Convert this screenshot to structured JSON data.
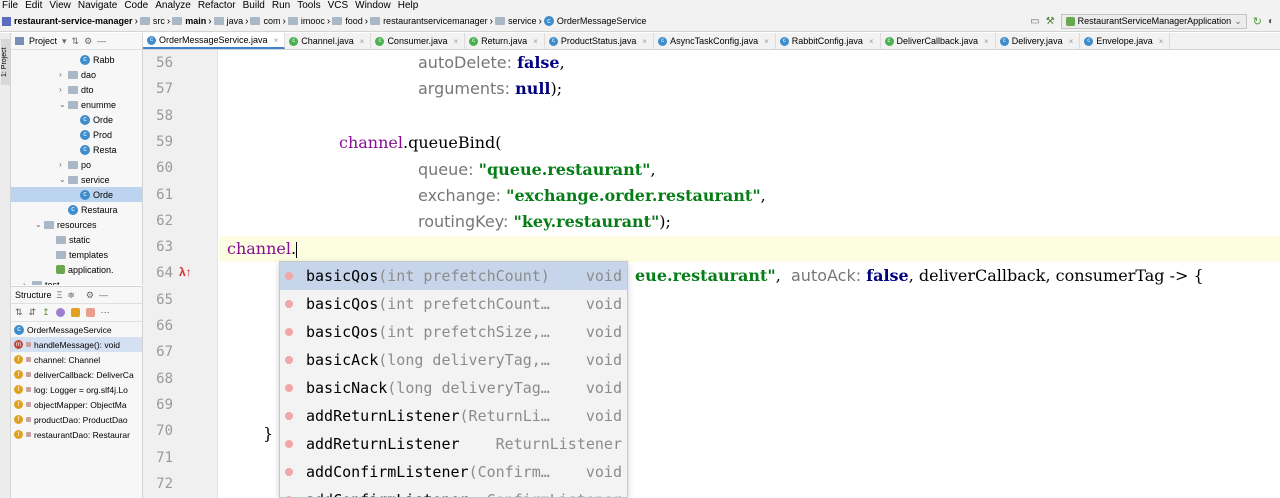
{
  "menu": [
    "File",
    "Edit",
    "View",
    "Navigate",
    "Code",
    "Analyze",
    "Refactor",
    "Build",
    "Run",
    "Tools",
    "VCS",
    "Window",
    "Help"
  ],
  "breadcrumb": [
    "restaurant-service-manager",
    "src",
    "main",
    "java",
    "com",
    "imooc",
    "food",
    "restaurantservicemanager",
    "service",
    "OrderMessageService"
  ],
  "run_config": "RestaurantServiceManagerApplication",
  "left_strip_label": "1: Project",
  "project_panel": {
    "title": "Project",
    "rows": [
      {
        "label": "Rabb",
        "indent": 5,
        "arrow": "",
        "icon": "class"
      },
      {
        "label": "dao",
        "indent": 4,
        "arrow": "›",
        "icon": "folder"
      },
      {
        "label": "dto",
        "indent": 4,
        "arrow": "›",
        "icon": "folder"
      },
      {
        "label": "enumme",
        "indent": 4,
        "arrow": "⌄",
        "icon": "folder"
      },
      {
        "label": "Orde",
        "indent": 5,
        "arrow": "",
        "icon": "class"
      },
      {
        "label": "Prod",
        "indent": 5,
        "arrow": "",
        "icon": "class"
      },
      {
        "label": "Resta",
        "indent": 5,
        "arrow": "",
        "icon": "class"
      },
      {
        "label": "po",
        "indent": 4,
        "arrow": "›",
        "icon": "folder"
      },
      {
        "label": "service",
        "indent": 4,
        "arrow": "⌄",
        "icon": "folder"
      },
      {
        "label": "Orde",
        "indent": 5,
        "arrow": "",
        "icon": "class",
        "selected": true
      },
      {
        "label": "Restaura",
        "indent": 4,
        "arrow": "",
        "icon": "class"
      },
      {
        "label": "resources",
        "indent": 2,
        "arrow": "⌄",
        "icon": "folder"
      },
      {
        "label": "static",
        "indent": 3,
        "arrow": "",
        "icon": "folder"
      },
      {
        "label": "templates",
        "indent": 3,
        "arrow": "",
        "icon": "folder"
      },
      {
        "label": "application.",
        "indent": 3,
        "arrow": "",
        "icon": "file"
      },
      {
        "label": "test",
        "indent": 1,
        "arrow": "›",
        "icon": "folder"
      }
    ]
  },
  "structure_panel": {
    "title": "Structure",
    "root": "OrderMessageService",
    "members": [
      {
        "badge": "m",
        "label": "handleMessage(): void",
        "selected": true
      },
      {
        "badge": "f",
        "label": "channel: Channel"
      },
      {
        "badge": "f",
        "label": "deliverCallback: DeliverCa"
      },
      {
        "badge": "f",
        "label": "log: Logger = org.slf4j.Lo"
      },
      {
        "badge": "f",
        "label": "objectMapper: ObjectMa"
      },
      {
        "badge": "f",
        "label": "productDao: ProductDao"
      },
      {
        "badge": "f",
        "label": "restaurantDao: Restaurar"
      }
    ]
  },
  "tabs": [
    {
      "label": "OrderMessageService.java",
      "active": true,
      "color": "#3d8ccb"
    },
    {
      "label": "Channel.java",
      "color": "#4caf50"
    },
    {
      "label": "Consumer.java",
      "color": "#4caf50"
    },
    {
      "label": "Return.java",
      "color": "#4caf50"
    },
    {
      "label": "ProductStatus.java",
      "color": "#3d8ccb"
    },
    {
      "label": "AsyncTaskConfig.java",
      "color": "#3d8ccb"
    },
    {
      "label": "RabbitConfig.java",
      "color": "#3d8ccb"
    },
    {
      "label": "DeliverCallback.java",
      "color": "#4caf50"
    },
    {
      "label": "Delivery.java",
      "color": "#3d8ccb"
    },
    {
      "label": "Envelope.java",
      "color": "#3d8ccb"
    }
  ],
  "editor": {
    "line_numbers": [
      "56",
      "57",
      "58",
      "59",
      "60",
      "61",
      "62",
      "63",
      "64",
      "65",
      "66",
      "67",
      "68",
      "69",
      "70",
      "71",
      "72"
    ],
    "l56_hint": "autoDelete:",
    "l56_val": "false",
    "l57_hint": "arguments:",
    "l57_val": "null",
    "l59_field": "channel",
    "l59_method": ".queueBind(",
    "l60_hint": "queue:",
    "l60_val": "\"queue.restaurant\"",
    "l61_hint": "exchange:",
    "l61_val": "\"exchange.order.restaurant\"",
    "l62_hint": "routingKey:",
    "l62_val": "\"key.restaurant\"",
    "l63_field": "channel",
    "l63_dot": ".",
    "l64_tail_str": "eue.restaurant\"",
    "l64_hint": "autoAck:",
    "l64_val": "false",
    "l64_rest": "deliverCallback, consumerTag -> {",
    "l70_brace": "}"
  },
  "completion": [
    {
      "name": "basicQos",
      "params": "(int prefetchCount)",
      "ret": "void",
      "selected": true
    },
    {
      "name": "basicQos",
      "params": "(int prefetchCount…",
      "ret": "void"
    },
    {
      "name": "basicQos",
      "params": "(int prefetchSize,…",
      "ret": "void"
    },
    {
      "name": "basicAck",
      "params": "(long deliveryTag,…",
      "ret": "void"
    },
    {
      "name": "basicNack",
      "params": "(long deliveryTag…",
      "ret": "void"
    },
    {
      "name": "addReturnListener",
      "params": "(ReturnLi…",
      "ret": "void"
    },
    {
      "name": "addReturnListener",
      "params": "",
      "ret": "ReturnListener"
    },
    {
      "name": "addConfirmListener",
      "params": "(Confirm…",
      "ret": "void"
    },
    {
      "name": "addConfirmListener",
      "params": "",
      "ret": "ConfirmListener"
    }
  ]
}
